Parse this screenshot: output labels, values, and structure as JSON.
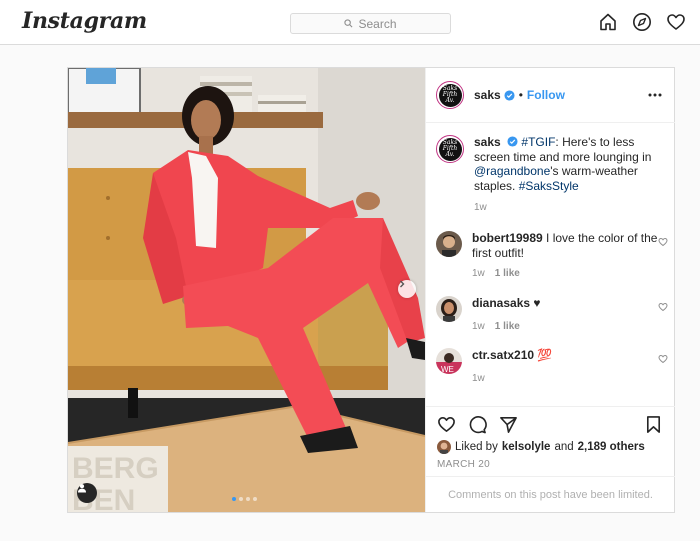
{
  "header": {
    "logo": "Instagram",
    "search_placeholder": "Search"
  },
  "post": {
    "username": "saks",
    "follow_label": "Follow",
    "separator": "•",
    "avatar_text": "Saks Fifth Avenue",
    "caption": {
      "hashtag1": "#TGIF",
      "text1": ": Here's to less screen time and more lounging in ",
      "mention": "@ragandbone",
      "text2": "'s warm-weather staples. ",
      "hashtag2": "#SaksStyle",
      "time": "1w"
    },
    "comments": [
      {
        "username": "bobert19989",
        "text": "I love the color of the first outfit!",
        "time": "1w",
        "likes": "1 like"
      },
      {
        "username": "dianasaks",
        "text": "♥",
        "time": "1w",
        "likes": "1 like"
      },
      {
        "username": "ctr.satx210",
        "text": "💯",
        "time": "1w",
        "likes": ""
      }
    ],
    "liked_by_prefix": "Liked by",
    "liked_by_user": "kelsolyle",
    "liked_by_and": "and",
    "liked_by_count": "2,189 others",
    "date": "MARCH 20",
    "comments_limited": "Comments on this post have been limited.",
    "carousel": {
      "count": 4,
      "active_index": 0
    },
    "photo_text": "BERG BEN"
  },
  "colors": {
    "accent": "#3897f0",
    "suit": "#f0464f",
    "sofa": "#d9a24b",
    "table": "#dcb27e"
  }
}
